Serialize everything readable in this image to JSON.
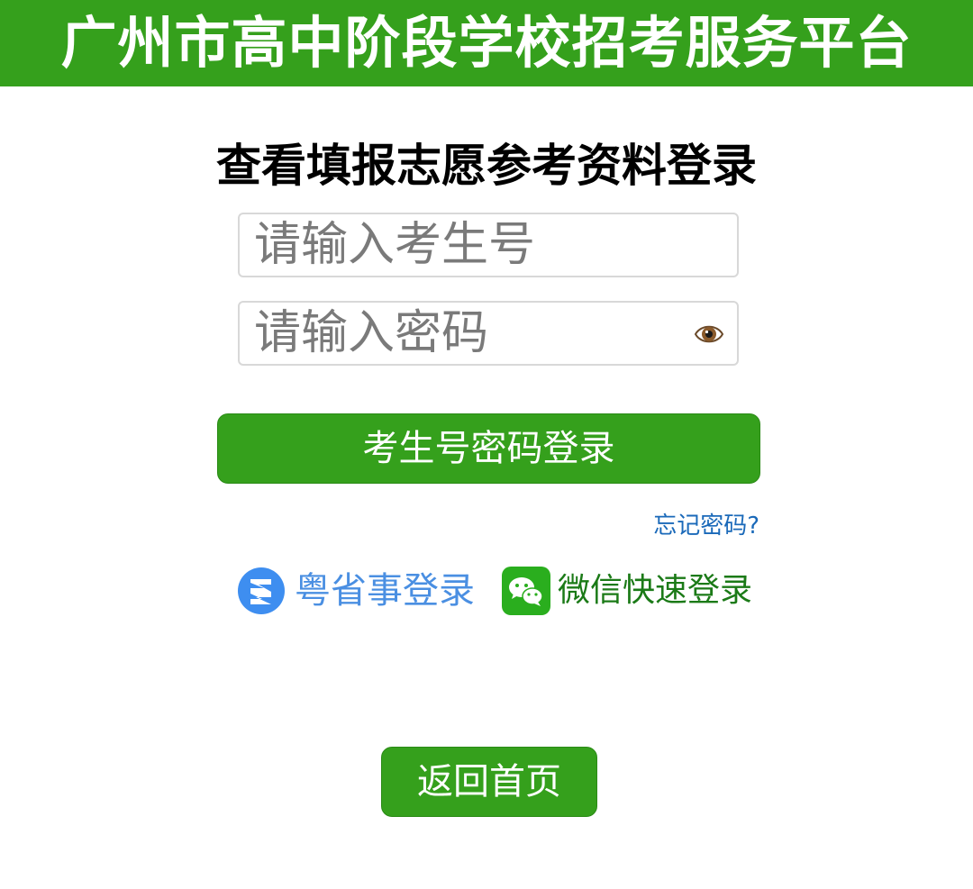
{
  "header": {
    "title": "广州市高中阶段学校招考服务平台",
    "background_color": "#35a01c"
  },
  "login": {
    "title": "查看填报志愿参考资料登录",
    "username": {
      "placeholder": "请输入考生号",
      "value": ""
    },
    "password": {
      "placeholder": "请输入密码",
      "value": "",
      "toggle_icon": "eye-icon"
    },
    "submit_label": "考生号密码登录",
    "forgot_label": "忘记密码?",
    "alternatives": [
      {
        "label": "粤省事登录",
        "icon": "yueshengshi-icon",
        "color": "#4a8fe2"
      },
      {
        "label": "微信快速登录",
        "icon": "wechat-icon",
        "color": "#1b7a17"
      }
    ]
  },
  "footer": {
    "home_label": "返回首页"
  },
  "colors": {
    "primary": "#35a01c",
    "link": "#1a69b9"
  }
}
